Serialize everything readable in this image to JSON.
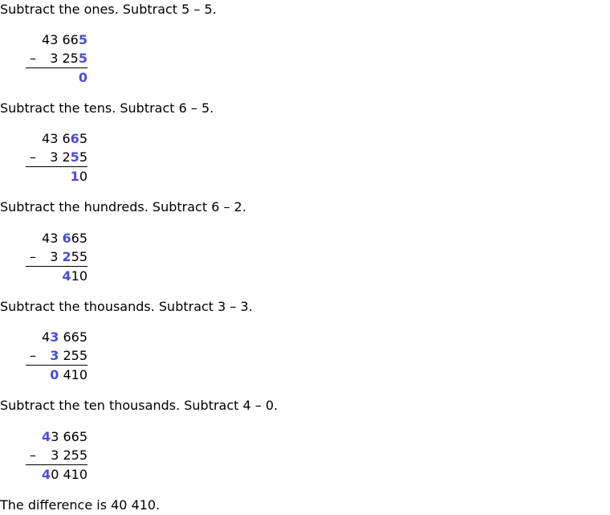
{
  "steps": [
    {
      "instruction": "Subtract the ones. Subtract 5 – 5.",
      "minus_sign": "–",
      "minuend": {
        "before": "43 66",
        "highlight": "5",
        "after": ""
      },
      "subtrahend": {
        "before": "3 25",
        "highlight": "5",
        "after": ""
      },
      "result": {
        "before": "",
        "highlight": "0",
        "after": ""
      }
    },
    {
      "instruction": "Subtract the tens. Subtract 6 – 5.",
      "minus_sign": "–",
      "minuend": {
        "before": "43 6",
        "highlight": "6",
        "after": "5"
      },
      "subtrahend": {
        "before": "3 2",
        "highlight": "5",
        "after": "5"
      },
      "result": {
        "before": "",
        "highlight": "1",
        "after": "0"
      }
    },
    {
      "instruction": "Subtract the hundreds. Subtract 6 – 2.",
      "minus_sign": "–",
      "minuend": {
        "before": "43 ",
        "highlight": "6",
        "after": "65"
      },
      "subtrahend": {
        "before": "3 ",
        "highlight": "2",
        "after": "55"
      },
      "result": {
        "before": "",
        "highlight": "4",
        "after": "10"
      }
    },
    {
      "instruction": "Subtract the thousands. Subtract 3 – 3.",
      "minus_sign": "–",
      "minuend": {
        "before": "4",
        "highlight": "3",
        "after": " 665"
      },
      "subtrahend": {
        "before": "",
        "highlight": "3",
        "after": " 255"
      },
      "result": {
        "before": "",
        "highlight": "0",
        "after": " 410"
      }
    },
    {
      "instruction": "Subtract the ten thousands. Subtract 4 – 0.",
      "minus_sign": "–",
      "minuend": {
        "before": "",
        "highlight": "4",
        "after": "3 665"
      },
      "subtrahend": {
        "before": "",
        "highlight": "",
        "after": "3 255"
      },
      "result": {
        "before": "",
        "highlight": "4",
        "after": "0 410"
      }
    }
  ],
  "conclusion": "The difference is 40 410.",
  "colors": {
    "highlight": "#4a4ae8",
    "text": "#000000",
    "background": "#ffffff"
  }
}
